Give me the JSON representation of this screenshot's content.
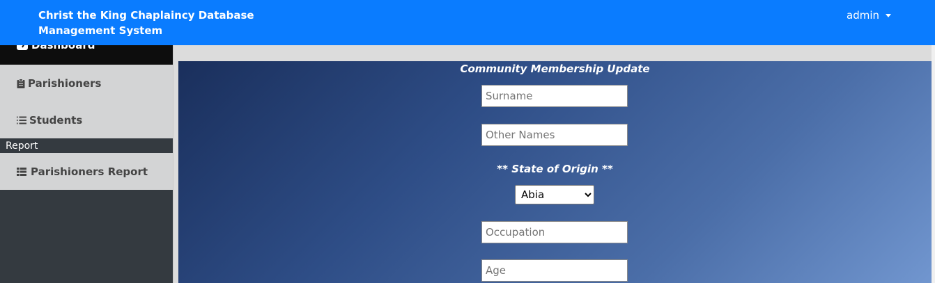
{
  "header": {
    "brand": "Christ the King Chaplaincy Database Management System",
    "user_menu_label": "admin"
  },
  "sidebar": {
    "dashboard_label": "Dashboard",
    "items": [
      {
        "label": "Parishioners",
        "icon": "clipboard-icon"
      },
      {
        "label": "Students",
        "icon": "list-ol-icon"
      }
    ],
    "report_heading": "Report",
    "report_items": [
      {
        "label": "Parishioners Report",
        "icon": "table-icon"
      }
    ]
  },
  "form": {
    "title": "Community Membership Update",
    "surname_placeholder": "Surname",
    "other_names_placeholder": "Other Names",
    "state_label": "** State of Origin **",
    "state_selected": "Abia",
    "state_options": [
      "Abia"
    ],
    "occupation_placeholder": "Occupation",
    "age_placeholder": "Age"
  },
  "colors": {
    "navbar": "#0a7cff",
    "sidebar_dark": "#343a40",
    "sidebar_item": "#d3d4d5"
  }
}
